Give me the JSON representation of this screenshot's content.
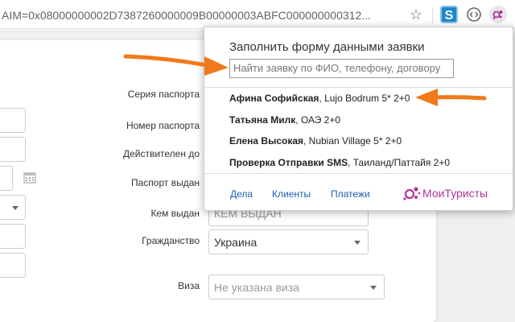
{
  "browser": {
    "url": "AIM=0x08000000002D7387260000009B00000003ABFC000000000312...",
    "extension_s_label": "S"
  },
  "form": {
    "labels": {
      "passport_series": "Серия паспорта",
      "passport_number": "Номер паспорта",
      "valid_until": "Действителен до",
      "issued": "Паспорт выдан",
      "issued_by": "Кем выдан",
      "citizenship": "Гражданство",
      "visa": "Виза"
    },
    "issued_by_placeholder": "КЕМ ВЫДАН",
    "citizenship_value": "Украина",
    "visa_value": "Не указана виза"
  },
  "popup": {
    "title": "Заполнить форму данными заявки",
    "search_placeholder": "Найти заявку по ФИО, телефону, договору",
    "items": [
      {
        "name": "Афина Софийская",
        "detail": ", Lujo Bodrum 5* 2+0"
      },
      {
        "name": "Татьяна Милк",
        "detail": ", ОАЭ 2+0"
      },
      {
        "name": "Елена Высокая",
        "detail": ", Nubian Village 5* 2+0"
      },
      {
        "name": "Проверка Отправки SMS",
        "detail": ", Таиланд/Паттайя 2+0"
      }
    ],
    "footer_links": [
      "Дела",
      "Клиенты",
      "Платежи"
    ],
    "brand": "МоиТуристы"
  },
  "colors": {
    "accent_orange": "#f07a1a",
    "link_blue": "#1a5fb4",
    "brand_magenta": "#b0349a"
  }
}
